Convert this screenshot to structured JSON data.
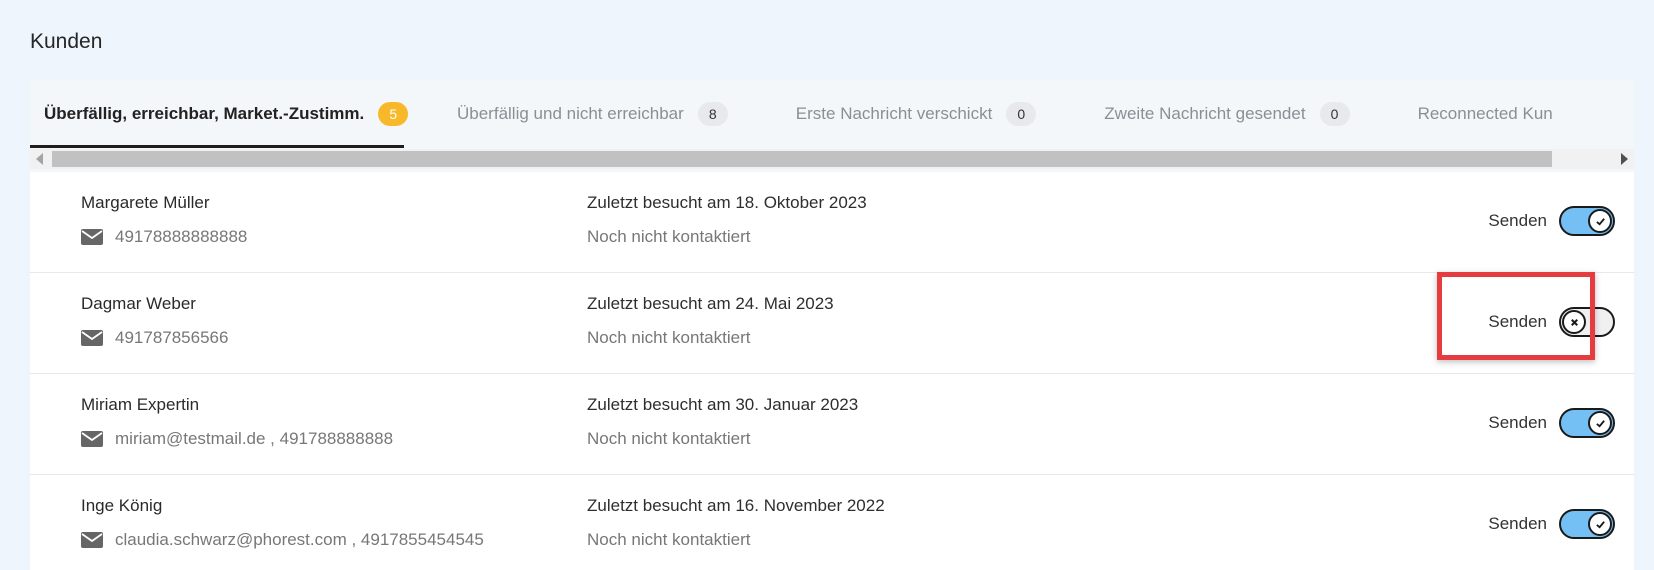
{
  "page": {
    "title": "Kunden"
  },
  "tabs": [
    {
      "label": "Überfällig, erreichbar, Market.-Zustimm.",
      "count": "5",
      "active": true
    },
    {
      "label": "Überfällig und nicht erreichbar",
      "count": "8",
      "active": false
    },
    {
      "label": "Erste Nachricht verschickt",
      "count": "0",
      "active": false
    },
    {
      "label": "Zweite Nachricht gesendet",
      "count": "0",
      "active": false
    },
    {
      "label": "Reconnected Kun",
      "count": "",
      "active": false
    }
  ],
  "customers": [
    {
      "name": "Margarete Müller",
      "contact": "49178888888888",
      "visited": "Zuletzt besucht am 18. Oktober 2023",
      "status": "Noch nicht kontaktiert",
      "send_label": "Senden",
      "send_enabled": true
    },
    {
      "name": "Dagmar Weber",
      "contact": "491787856566",
      "visited": "Zuletzt besucht am 24. Mai 2023",
      "status": "Noch nicht kontaktiert",
      "send_label": "Senden",
      "send_enabled": false
    },
    {
      "name": "Miriam Expertin",
      "contact": "miriam@testmail.de , 491788888888",
      "visited": "Zuletzt besucht am 30. Januar 2023",
      "status": "Noch nicht kontaktiert",
      "send_label": "Senden",
      "send_enabled": true
    },
    {
      "name": "Inge König",
      "contact": "claudia.schwarz@phorest.com , 4917855454545",
      "visited": "Zuletzt besucht am 16. November 2022",
      "status": "Noch nicht kontaktiert",
      "send_label": "Senden",
      "send_enabled": true
    }
  ],
  "icons": {
    "contact": "envelope-icon",
    "toggle_on": "check-icon",
    "toggle_off": "x-icon"
  },
  "colors": {
    "accent": "#74c0f5",
    "badge_active": "#f7b82a",
    "highlight": "#e63b3f",
    "background": "#eef5fd"
  }
}
